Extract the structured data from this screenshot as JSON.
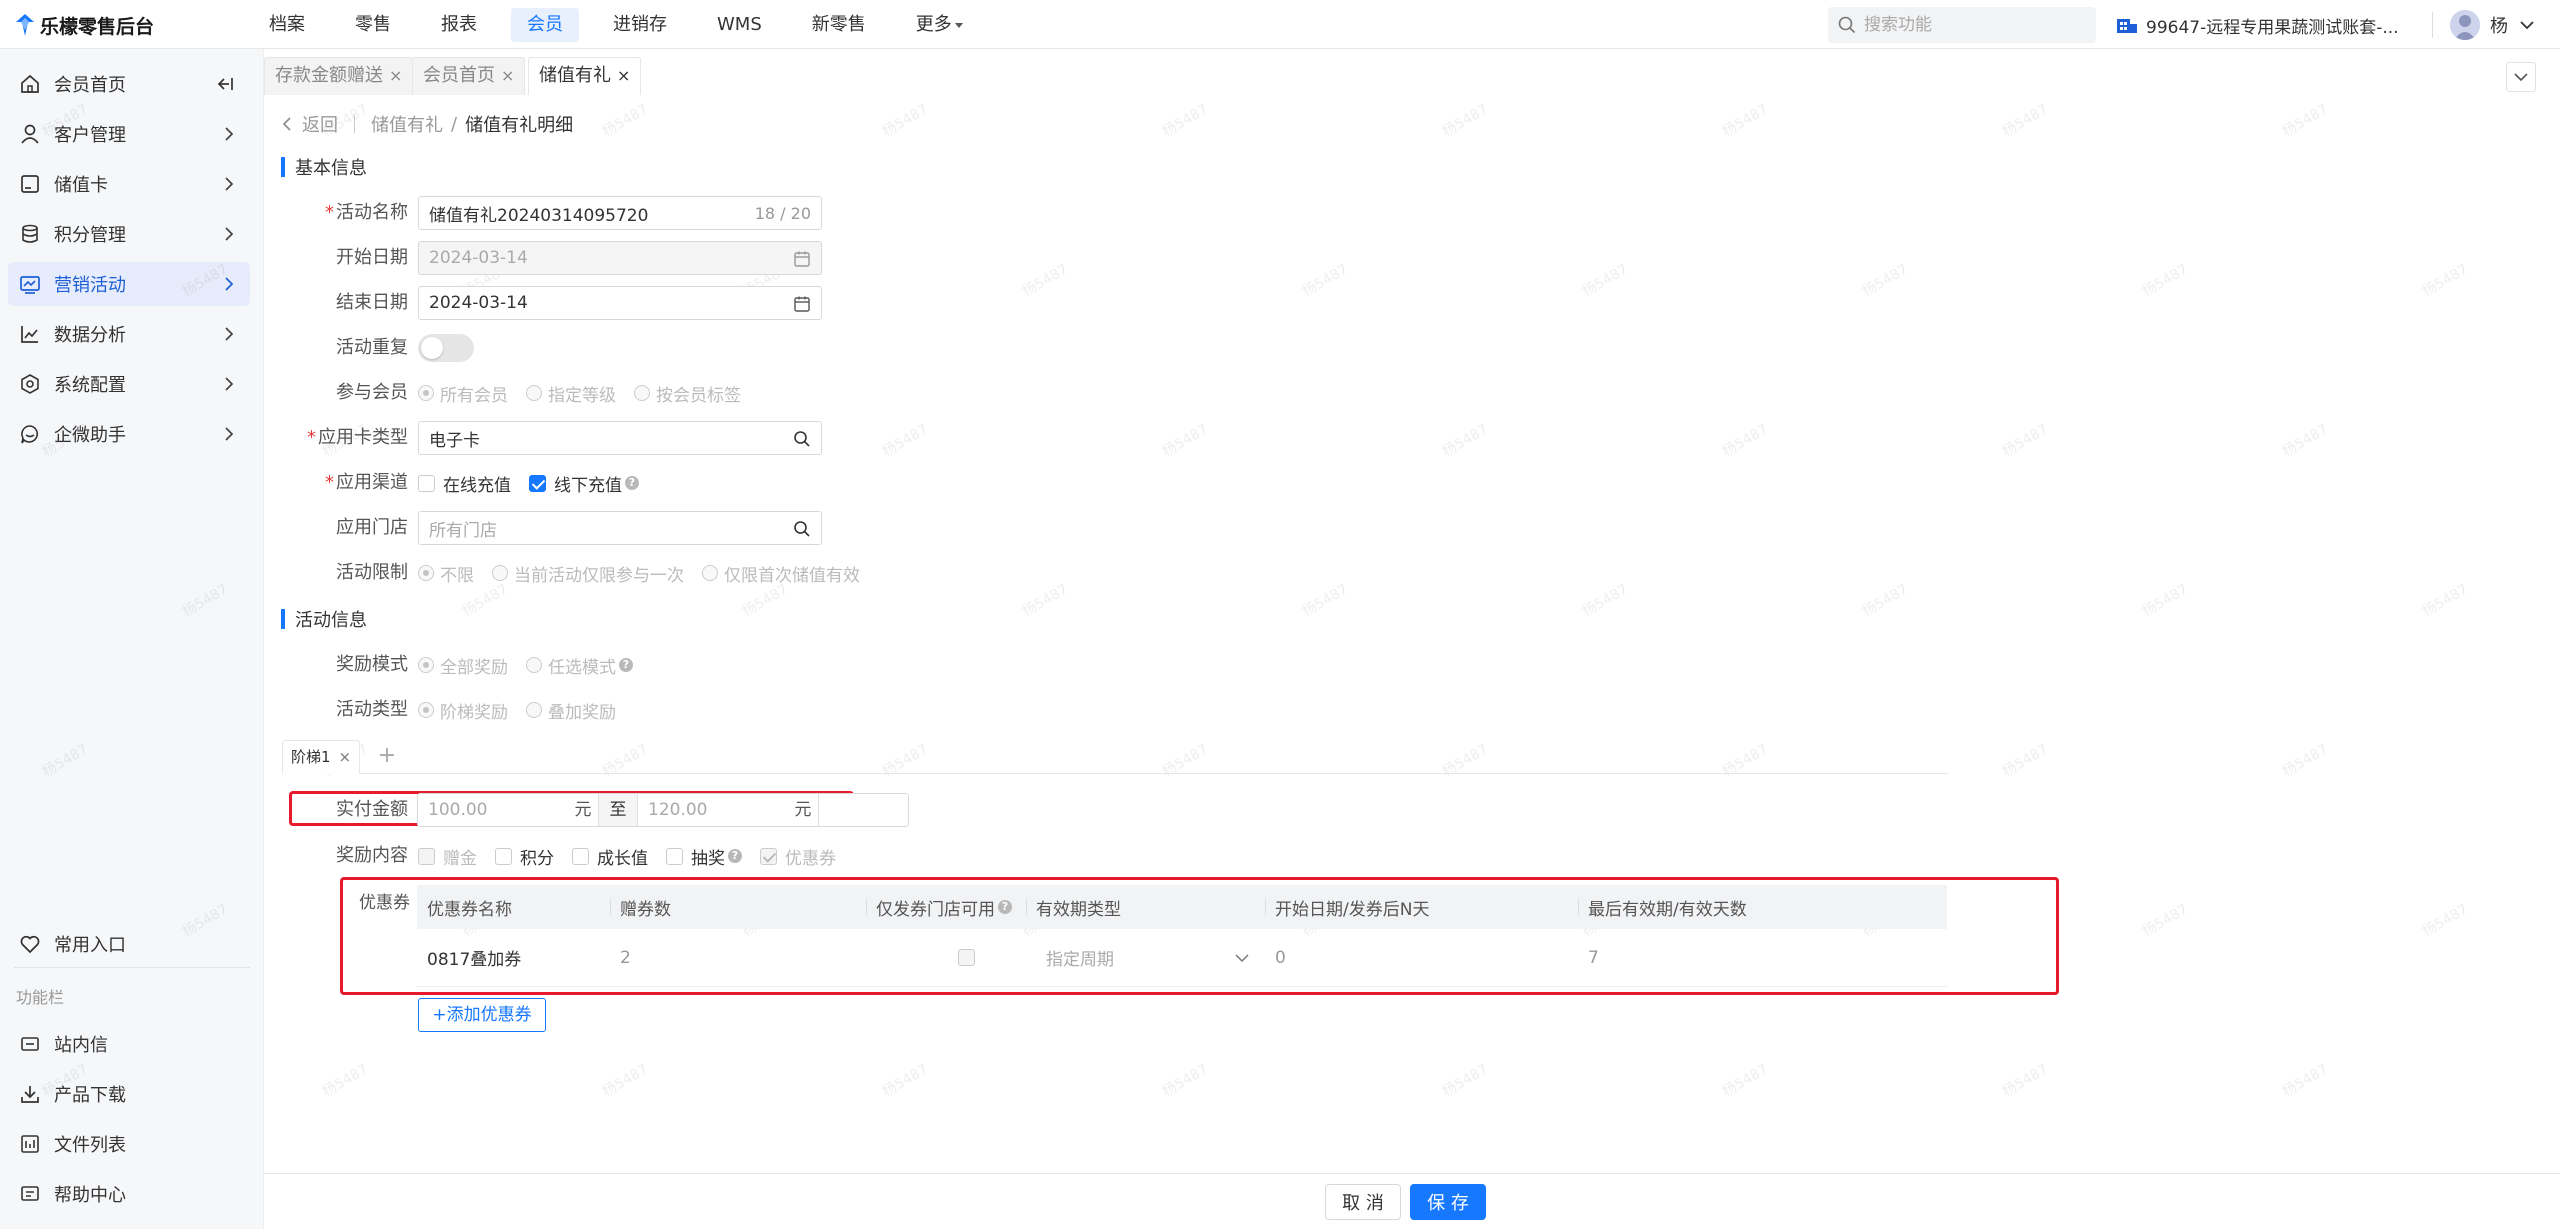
{
  "brand": {
    "name": "乐檬零售后台",
    "accent": "#1677ff"
  },
  "topnav": [
    {
      "label": "档案",
      "active": false
    },
    {
      "label": "零售",
      "active": false
    },
    {
      "label": "报表",
      "active": false
    },
    {
      "label": "会员",
      "active": true
    },
    {
      "label": "进销存",
      "active": false
    },
    {
      "label": "WMS",
      "active": false
    },
    {
      "label": "新零售",
      "active": false
    },
    {
      "label": "更多",
      "active": false,
      "dropdown": true
    }
  ],
  "search": {
    "placeholder": "搜索功能"
  },
  "account": {
    "label": "99647-远程专用果蔬测试账套-..."
  },
  "user": {
    "name": "杨"
  },
  "sidebar": {
    "items": [
      {
        "label": "会员首页",
        "icon": "home-icon"
      },
      {
        "label": "客户管理",
        "icon": "user-icon"
      },
      {
        "label": "储值卡",
        "icon": "card-icon"
      },
      {
        "label": "积分管理",
        "icon": "database-icon"
      },
      {
        "label": "营销活动",
        "icon": "monitor-icon",
        "active": true
      },
      {
        "label": "数据分析",
        "icon": "chart-line-icon"
      },
      {
        "label": "系统配置",
        "icon": "settings-icon"
      },
      {
        "label": "企微助手",
        "icon": "chat-icon"
      }
    ],
    "favorites": {
      "label": "常用入口",
      "icon": "heart-icon"
    },
    "group_label": "功能栏",
    "tools": [
      {
        "label": "站内信",
        "icon": "mail-icon"
      },
      {
        "label": "产品下载",
        "icon": "download-icon"
      },
      {
        "label": "文件列表",
        "icon": "file-list-icon"
      },
      {
        "label": "帮助中心",
        "icon": "help-icon"
      }
    ]
  },
  "tabs": [
    {
      "label": "存款金额赠送",
      "active": false
    },
    {
      "label": "会员首页",
      "active": false
    },
    {
      "label": "储值有礼",
      "active": true
    }
  ],
  "breadcrumb": {
    "back": "返回",
    "parent": "储值有礼",
    "current": "储值有礼明细"
  },
  "basic": {
    "title": "基本信息",
    "name": {
      "label": "活动名称",
      "value": "储值有礼20240314095720",
      "count": "18 / 20"
    },
    "start": {
      "label": "开始日期",
      "value": "2024-03-14"
    },
    "end": {
      "label": "结束日期",
      "value": "2024-03-14"
    },
    "repeat": {
      "label": "活动重复",
      "on": false
    },
    "members": {
      "label": "参与会员",
      "options": [
        "所有会员",
        "指定等级",
        "按会员标签"
      ],
      "selected": 0
    },
    "card_type": {
      "label": "应用卡类型",
      "value": "电子卡"
    },
    "channel": {
      "label": "应用渠道",
      "online": "在线充值",
      "offline": "线下充值",
      "online_checked": false,
      "offline_checked": true
    },
    "store": {
      "label": "应用门店",
      "placeholder": "所有门店"
    },
    "limit": {
      "label": "活动限制",
      "options": [
        "不限",
        "当前活动仅限参与一次",
        "仅限首次储值有效"
      ],
      "selected": 0
    }
  },
  "activity": {
    "title": "活动信息",
    "reward_mode": {
      "label": "奖励模式",
      "options": [
        "全部奖励",
        "任选模式"
      ],
      "selected": 0
    },
    "activity_type": {
      "label": "活动类型",
      "options": [
        "阶梯奖励",
        "叠加奖励"
      ],
      "selected": 0
    },
    "step_tab": "阶梯1",
    "amount": {
      "label": "实付金额",
      "min": "100.00",
      "max": "120.00",
      "unit": "元",
      "to": "至"
    },
    "content": {
      "label": "奖励内容",
      "options": [
        "赠金",
        "积分",
        "成长值",
        "抽奖",
        "优惠券"
      ]
    },
    "coupon": {
      "label": "优惠券",
      "columns": [
        "优惠券名称",
        "赠券数",
        "仅发券门店可用",
        "有效期类型",
        "开始日期/发券后N天",
        "最后有效期/有效天数"
      ],
      "rows": [
        {
          "name": "0817叠加券",
          "qty": "2",
          "store_only": false,
          "validity_type": "指定周期",
          "start": "0",
          "end": "7"
        }
      ],
      "add_label": "+添加优惠券"
    }
  },
  "footer": {
    "cancel": "取 消",
    "save": "保 存"
  },
  "watermark": "杨5487"
}
